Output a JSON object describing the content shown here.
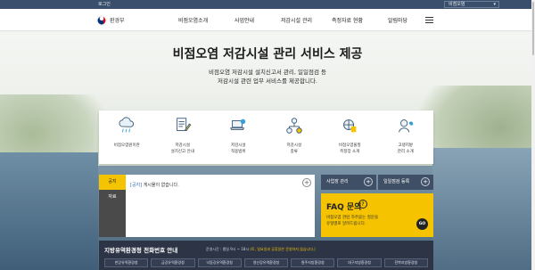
{
  "topbar": {
    "login_label": "로그인",
    "site_select": "비점오염"
  },
  "header": {
    "logo_text": "환경부",
    "menu": [
      "비점오염소개",
      "사업안내",
      "저감시설 관리",
      "측정자료 현황",
      "알림마당"
    ]
  },
  "hero": {
    "title": "비점오염 저감시설 관리 서비스 제공",
    "subtitle_line1": "비점오염 저감시설 설치신고서 관리, 일일점검 등",
    "subtitle_line2": "저감시설 관련 업무 서비스를 제공합니다."
  },
  "services": [
    {
      "line1": "비점오염원이란",
      "line2": "",
      "icon": "cloud-rain-icon"
    },
    {
      "line1": "저감시설",
      "line2": "설치신고 안내",
      "icon": "document-pen-icon"
    },
    {
      "line1": "저감시설",
      "line2": "적용범위",
      "icon": "laptop-settings-icon"
    },
    {
      "line1": "저감시설",
      "line2": "종류",
      "icon": "network-icon"
    },
    {
      "line1": "비점오염물질",
      "line2": "측정장 소개",
      "icon": "globe-document-icon"
    },
    {
      "line1": "고랭지밭",
      "line2": "관리 소개",
      "icon": "leaf-person-icon"
    }
  ],
  "notice": {
    "tabs": [
      "공지",
      "자료"
    ],
    "tag": "[공지]",
    "message": "게시물이 없습니다."
  },
  "quick_links": [
    "사업장 관리",
    "일일점검 등록"
  ],
  "faq": {
    "title": "FAQ 문의",
    "desc_line1": "비점오염 관련 자주묻는 질문을",
    "desc_line2": "유형별로 알려드립니다.",
    "go_label": "GO"
  },
  "phone_panel": {
    "title": "지방유역환경청 전화번호 안내",
    "hours_prefix": "운영시간 : 평일 9시 ~ 18시",
    "hours_note": "(토, 일요일과 공휴일은 운영하지 않습니다.)",
    "offices": [
      "한강유역환경청",
      "금강유역환경청",
      "낙동강유역환경청",
      "영산강유역환경청",
      "원주지방환경청",
      "대구지방환경청",
      "전북지방환경청"
    ]
  },
  "colors": {
    "accent_yellow": "#f6c300",
    "navy": "#2c3446",
    "topbar": "#3a4f6b"
  }
}
